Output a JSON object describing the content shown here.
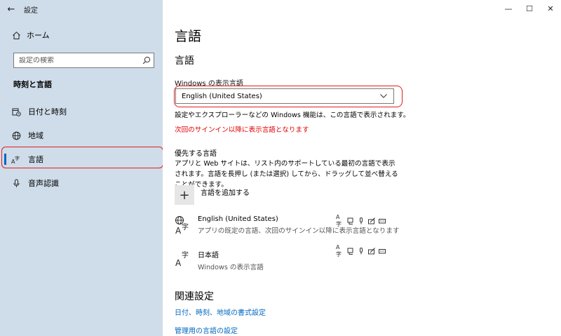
{
  "app": {
    "title": "設定",
    "back_glyph": "←",
    "controls": {
      "minimize": "—",
      "maximize": "☐",
      "close": "✕"
    }
  },
  "sidebar": {
    "home_label": "ホーム",
    "search_placeholder": "設定の検索",
    "section_title": "時刻と言語",
    "items": [
      {
        "label": "日付と時刻",
        "icon": "calendar-clock-icon"
      },
      {
        "label": "地域",
        "icon": "globe-icon"
      },
      {
        "label": "言語",
        "icon": "language-icon",
        "selected": true
      },
      {
        "label": "音声認識",
        "icon": "microphone-icon"
      }
    ]
  },
  "main": {
    "page_title": "言語",
    "subhead": "言語",
    "display_language_label": "Windows の表示言語",
    "display_language_value": "English (United States)",
    "display_language_desc": "設定やエクスプローラーなどの Windows 機能は、この言語で表示されます。",
    "warning": "次回のサインイン以降に表示言語となります",
    "preferred_heading": "優先する言語",
    "preferred_desc": "アプリと Web サイトは、リスト内のサポートしている最初の言語で表示されます。言語を長押し (または選択) してから、ドラッグして並べ替えることができます。",
    "add_language_label": "言語を追加する",
    "languages": [
      {
        "name": "English (United States)",
        "sub": "アプリの既定の言語、次回のサインイン以降に表示言語となります"
      },
      {
        "name": "日本語",
        "sub": "Windows の表示言語"
      }
    ],
    "related_heading": "関連設定",
    "links": [
      "日付、時刻、地域の書式設定",
      "管理用の言語の設定"
    ]
  },
  "colors": {
    "sidebar_bg": "#cfdce9",
    "accent": "#0067c0",
    "warning": "#e00000",
    "annotation": "#e31d1d"
  }
}
